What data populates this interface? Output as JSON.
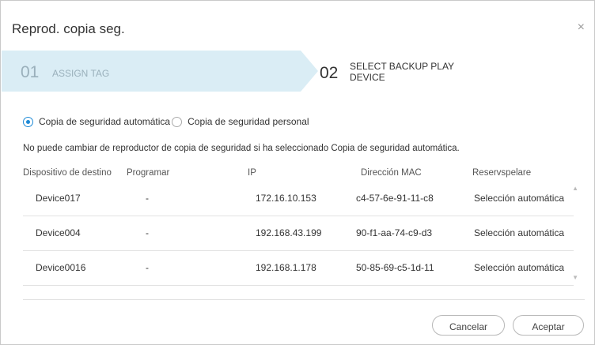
{
  "dialog": {
    "title": "Reprod. copia seg.",
    "close_glyph": "×"
  },
  "steps": [
    {
      "number": "01",
      "label": "ASSIGN TAG",
      "active": false
    },
    {
      "number": "02",
      "label": "SELECT BACKUP PLAY DEVICE",
      "active": true
    }
  ],
  "backup_options": {
    "automatic": "Copia de seguridad automática",
    "personal": "Copia de seguridad personal",
    "selected": "automatic"
  },
  "note": "No puede cambiar de reproductor de copia de seguridad si ha seleccionado Copia de seguridad automática.",
  "table": {
    "headers": [
      "Dispositivo de destino",
      "Programar",
      "IP",
      "Dirección MAC",
      "Reservspelare"
    ],
    "rows": [
      {
        "device": "Device017",
        "schedule": "-",
        "ip": "172.16.10.153",
        "mac": "c4-57-6e-91-11-c8",
        "reserve": "Selección automática"
      },
      {
        "device": "Device004",
        "schedule": "-",
        "ip": "192.168.43.199",
        "mac": "90-f1-aa-74-c9-d3",
        "reserve": "Selección automática"
      },
      {
        "device": "Device0016",
        "schedule": "-",
        "ip": "192.168.1.178",
        "mac": "50-85-69-c5-1d-11",
        "reserve": "Selección automática"
      }
    ]
  },
  "buttons": {
    "cancel": "Cancelar",
    "accept": "Aceptar"
  },
  "colors": {
    "accent": "#1e8ad6",
    "step_inactive_bg": "#daedf5"
  }
}
